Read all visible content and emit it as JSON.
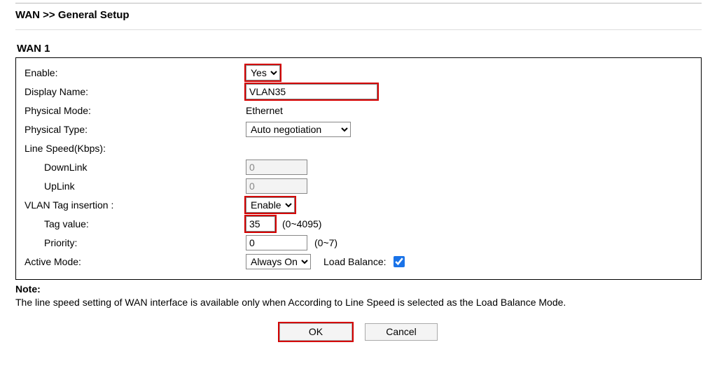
{
  "page_title": "WAN >> General Setup",
  "section_title": "WAN 1",
  "labels": {
    "enable": "Enable:",
    "display_name": "Display Name:",
    "physical_mode": "Physical Mode:",
    "physical_type": "Physical Type:",
    "line_speed": "Line Speed(Kbps):",
    "downlink": "DownLink",
    "uplink": "UpLink",
    "vlan_insertion": "VLAN Tag insertion :",
    "tag_value": "Tag value:",
    "priority": "Priority:",
    "active_mode": "Active Mode:",
    "load_balance": "Load Balance:"
  },
  "options": {
    "enable_sel": "Yes",
    "physical_type_sel": "Auto negotiation",
    "vlan_sel": "Enable",
    "active_mode_sel": "Always On"
  },
  "values": {
    "display_name": "VLAN35",
    "physical_mode": "Ethernet",
    "downlink": "0",
    "uplink": "0",
    "tag_value": "35",
    "priority": "0"
  },
  "ranges": {
    "tag_value": "(0~4095)",
    "priority": "(0~7)"
  },
  "note": {
    "label": "Note:",
    "text": "The line speed setting of WAN interface is available only when According to Line Speed is selected as the Load Balance Mode."
  },
  "buttons": {
    "ok": "OK",
    "cancel": "Cancel"
  }
}
